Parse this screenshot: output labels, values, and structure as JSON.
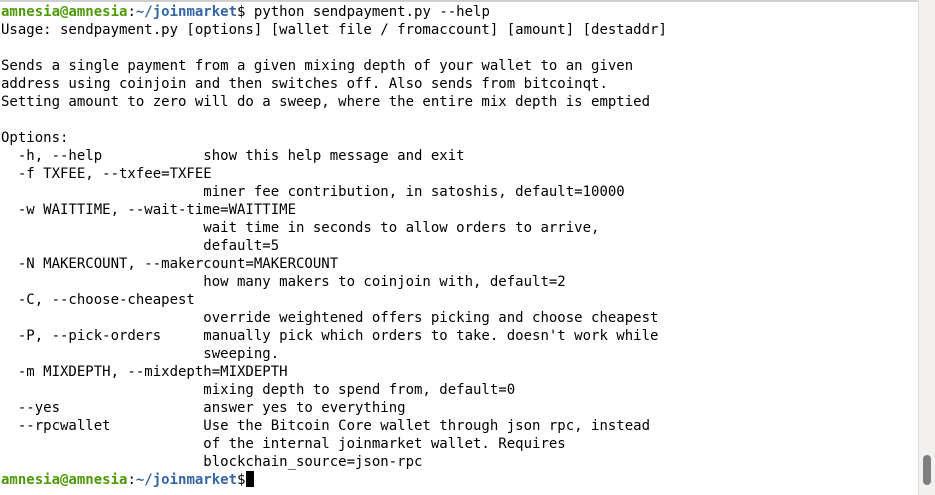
{
  "prompt": {
    "user_host": "amnesia@amnesia",
    "separator": ":",
    "path": "~/joinmarket",
    "symbol": "$"
  },
  "command": " python sendpayment.py --help",
  "output_lines": [
    "Usage: sendpayment.py [options] [wallet file / fromaccount] [amount] [destaddr]",
    "",
    "Sends a single payment from a given mixing depth of your wallet to an given",
    "address using coinjoin and then switches off. Also sends from bitcoinqt.",
    "Setting amount to zero will do a sweep, where the entire mix depth is emptied",
    "",
    "Options:",
    "  -h, --help            show this help message and exit",
    "  -f TXFEE, --txfee=TXFEE",
    "                        miner fee contribution, in satoshis, default=10000",
    "  -w WAITTIME, --wait-time=WAITTIME",
    "                        wait time in seconds to allow orders to arrive,",
    "                        default=5",
    "  -N MAKERCOUNT, --makercount=MAKERCOUNT",
    "                        how many makers to coinjoin with, default=2",
    "  -C, --choose-cheapest",
    "                        override weightened offers picking and choose cheapest",
    "  -P, --pick-orders     manually pick which orders to take. doesn't work while",
    "                        sweeping.",
    "  -m MIXDEPTH, --mixdepth=MIXDEPTH",
    "                        mixing depth to spend from, default=0",
    "  --yes                 answer yes to everything",
    "  --rpcwallet           Use the Bitcoin Core wallet through json rpc, instead",
    "                        of the internal joinmarket wallet. Requires",
    "                        blockchain_source=json-rpc"
  ],
  "colors": {
    "user_host": "#4e9a06",
    "path": "#3465a4",
    "background": "#ffffff",
    "text": "#000000"
  }
}
